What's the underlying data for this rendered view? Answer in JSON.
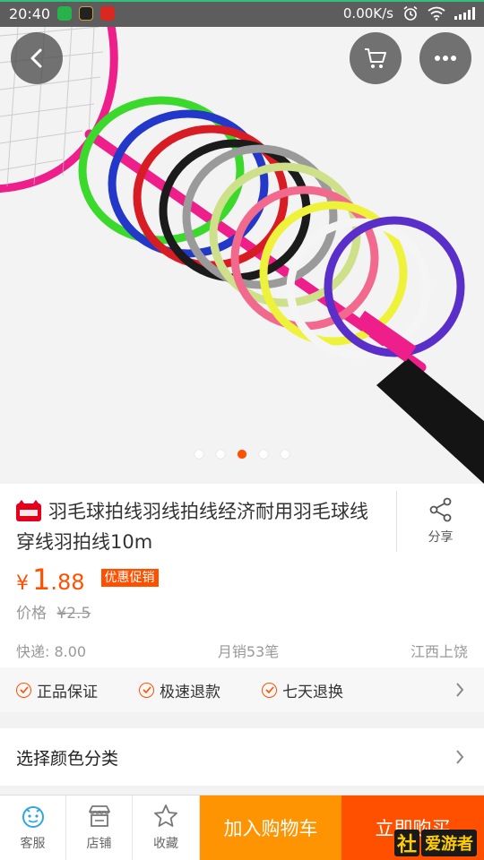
{
  "status_bar": {
    "time": "20:40",
    "network_speed": "0.00K/s",
    "icons": [
      "app-notification-icon",
      "game-icon",
      "news-icon",
      "alarm-icon",
      "wifi-icon",
      "signal-icon"
    ]
  },
  "hero": {
    "image_subject": "badminton strings in multiple colors on racket",
    "carousel_total": 5,
    "carousel_active": 3,
    "buttons": [
      "back-icon",
      "cart-icon",
      "more-icon"
    ]
  },
  "product": {
    "title": "羽毛球拍线羽线拍线经济耐用羽毛球线穿线羽拍线10m",
    "share_label": "分享",
    "price_symbol": "¥",
    "price_int": "1",
    "price_dec": ".88",
    "promo_label": "优惠促销",
    "old_price_label": "价格",
    "old_price": "¥2.5",
    "shipping": "快递: 8.00",
    "monthly_sales": "月销53笔",
    "location": "江西上饶"
  },
  "guarantees": {
    "items": [
      "正品保证",
      "极速退款",
      "七天退换"
    ]
  },
  "spec": {
    "label": "选择颜色分类"
  },
  "bottom_bar": {
    "service_label": "客服",
    "store_label": "店铺",
    "favorite_label": "收藏",
    "add_cart_label": "加入购物车",
    "buy_now_label": "立即购买",
    "watermark_text": "爱游者"
  },
  "colors": {
    "accent": "#ff5000",
    "cart_orange": "#ff9402",
    "link_blue": "#2ea7e0"
  }
}
